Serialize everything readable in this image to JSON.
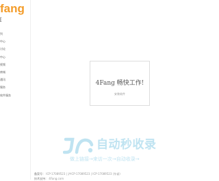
{
  "brand": {
    "logo_text": "fang",
    "sub_text": "[",
    "accent_color": "#f39c2a"
  },
  "nav": {
    "items": [
      {
        "label": "列"
      },
      {
        "label": "中心"
      },
      {
        "label": "讨论"
      },
      {
        "label": "中心"
      },
      {
        "label": "视频"
      },
      {
        "label": "商城"
      },
      {
        "label": "通讯"
      },
      {
        "label": "服务"
      },
      {
        "label": "软件服务"
      }
    ]
  },
  "card": {
    "title": "4Fang 畅快工作!",
    "subtitle": "安装软件"
  },
  "watermark": {
    "text": "自动秒收录",
    "slogan": "做上链接→来访一次→自动收录→",
    "color": "#bfe3f1"
  },
  "footer": {
    "line1_label": "备案号：",
    "line1_value": "ICP-17089523 | 沪ICP-17089523 | ICP-17089523 (东省)",
    "line2_label": "技术支持：",
    "line2_value": "4Fang.com"
  }
}
